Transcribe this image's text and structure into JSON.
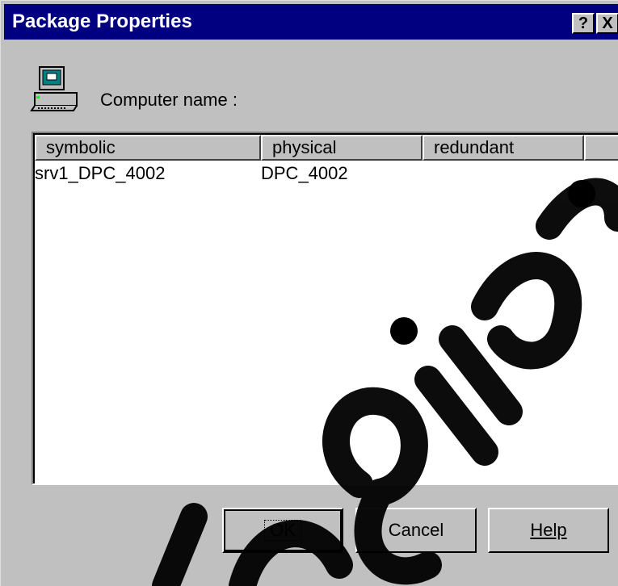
{
  "window": {
    "title": "Package Properties",
    "help_glyph": "?",
    "close_glyph": "X"
  },
  "computer": {
    "icon": "computer-icon",
    "label": "Computer name :"
  },
  "table": {
    "columns": [
      "symbolic",
      "physical",
      "redundant"
    ],
    "rows": [
      {
        "symbolic": "srv1_DPC_4002",
        "physical": "DPC_4002",
        "redundant": ""
      }
    ]
  },
  "buttons": {
    "ok": "OK",
    "cancel": "Cancel",
    "help": "Help"
  },
  "colors": {
    "titlebar": "#000080",
    "face": "#c0c0c0",
    "watermark": "#000000"
  }
}
